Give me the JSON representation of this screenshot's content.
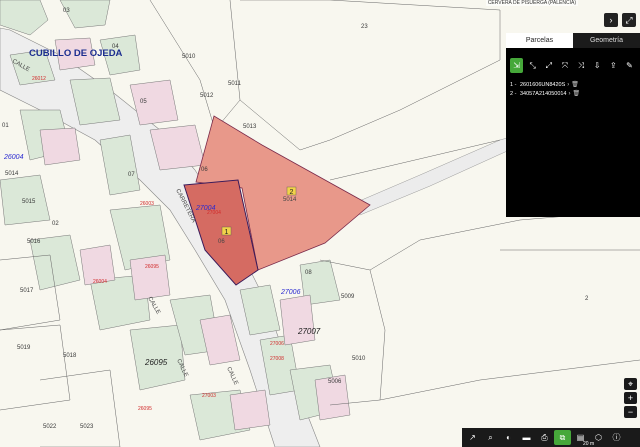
{
  "map": {
    "place_name": "CUBILLO DE OJEDA",
    "municipality": "CERVERA DE PISUERGA (PALENCIA)",
    "scale_label": "20 m",
    "selected_parcels": [
      {
        "badge": "1",
        "code": "06"
      },
      {
        "badge": "2",
        "code": "5014"
      }
    ],
    "street_labels": [
      "CALLE",
      "CARRETERA",
      "CALLE",
      "CALLE",
      "CALLE"
    ],
    "lot_numbers": [
      "5010",
      "5012",
      "5011",
      "5013",
      "5014",
      "5015",
      "5016",
      "5017",
      "5018",
      "5019",
      "5022",
      "5023",
      "5009",
      "5010",
      "5006",
      "23",
      "2",
      "03",
      "04",
      "01",
      "02",
      "05",
      "06",
      "07",
      "08"
    ],
    "block_numbers": [
      "27007",
      "26095",
      "27006",
      "26004",
      "27004"
    ],
    "reference_codes": [
      "26012",
      "26003",
      "26004",
      "26095",
      "27004",
      "27006",
      "27008",
      "27003",
      "26095"
    ]
  },
  "topbar": {
    "expand_icon": "expand-icon",
    "close_icon": "chevron-right-icon"
  },
  "panel": {
    "tabs": [
      {
        "label": "Parcelas",
        "active": true
      },
      {
        "label": "Geometría",
        "active": false
      }
    ],
    "tools": [
      {
        "icon": "add-parcel-icon",
        "glyph": "⇲",
        "active": true
      },
      {
        "icon": "measure-icon",
        "glyph": "⤡",
        "active": false
      },
      {
        "icon": "split-icon",
        "glyph": "⤢",
        "active": false
      },
      {
        "icon": "merge-icon",
        "glyph": "⤧",
        "active": false
      },
      {
        "icon": "area-icon",
        "glyph": "⤨",
        "active": false
      },
      {
        "icon": "export-icon",
        "glyph": "⇩",
        "active": false
      },
      {
        "icon": "upload-icon",
        "glyph": "⇪",
        "active": false
      },
      {
        "icon": "pencil-icon",
        "glyph": "✎",
        "active": false
      }
    ],
    "parcels": [
      {
        "index": "1 -",
        "ref": "2601606UN8420S"
      },
      {
        "index": "2 -",
        "ref": "34057A214050014"
      }
    ]
  },
  "bottom_bar": [
    {
      "icon": "expand-arrow-icon",
      "glyph": "↗"
    },
    {
      "icon": "zoom-search-icon",
      "glyph": "⌕"
    },
    {
      "icon": "globe-icon",
      "glyph": "◐"
    },
    {
      "icon": "ruler-icon",
      "glyph": "▬"
    },
    {
      "icon": "print-icon",
      "glyph": "⎙"
    },
    {
      "icon": "layers-icon",
      "glyph": "⧉",
      "active": true
    },
    {
      "icon": "chart-icon",
      "glyph": "▤"
    },
    {
      "icon": "overlay-icon",
      "glyph": "⬡"
    },
    {
      "icon": "info-icon",
      "glyph": "ⓘ"
    }
  ],
  "zoom": [
    {
      "icon": "locate-icon",
      "glyph": "⌖"
    },
    {
      "icon": "zoom-in-icon",
      "glyph": "+"
    },
    {
      "icon": "zoom-out-icon",
      "glyph": "−"
    }
  ],
  "colors": {
    "parcel_fill": "#e8988a",
    "parcel_selected": "#d56b62",
    "buildings": "#d9e6d7",
    "accent": "#46a83a"
  }
}
